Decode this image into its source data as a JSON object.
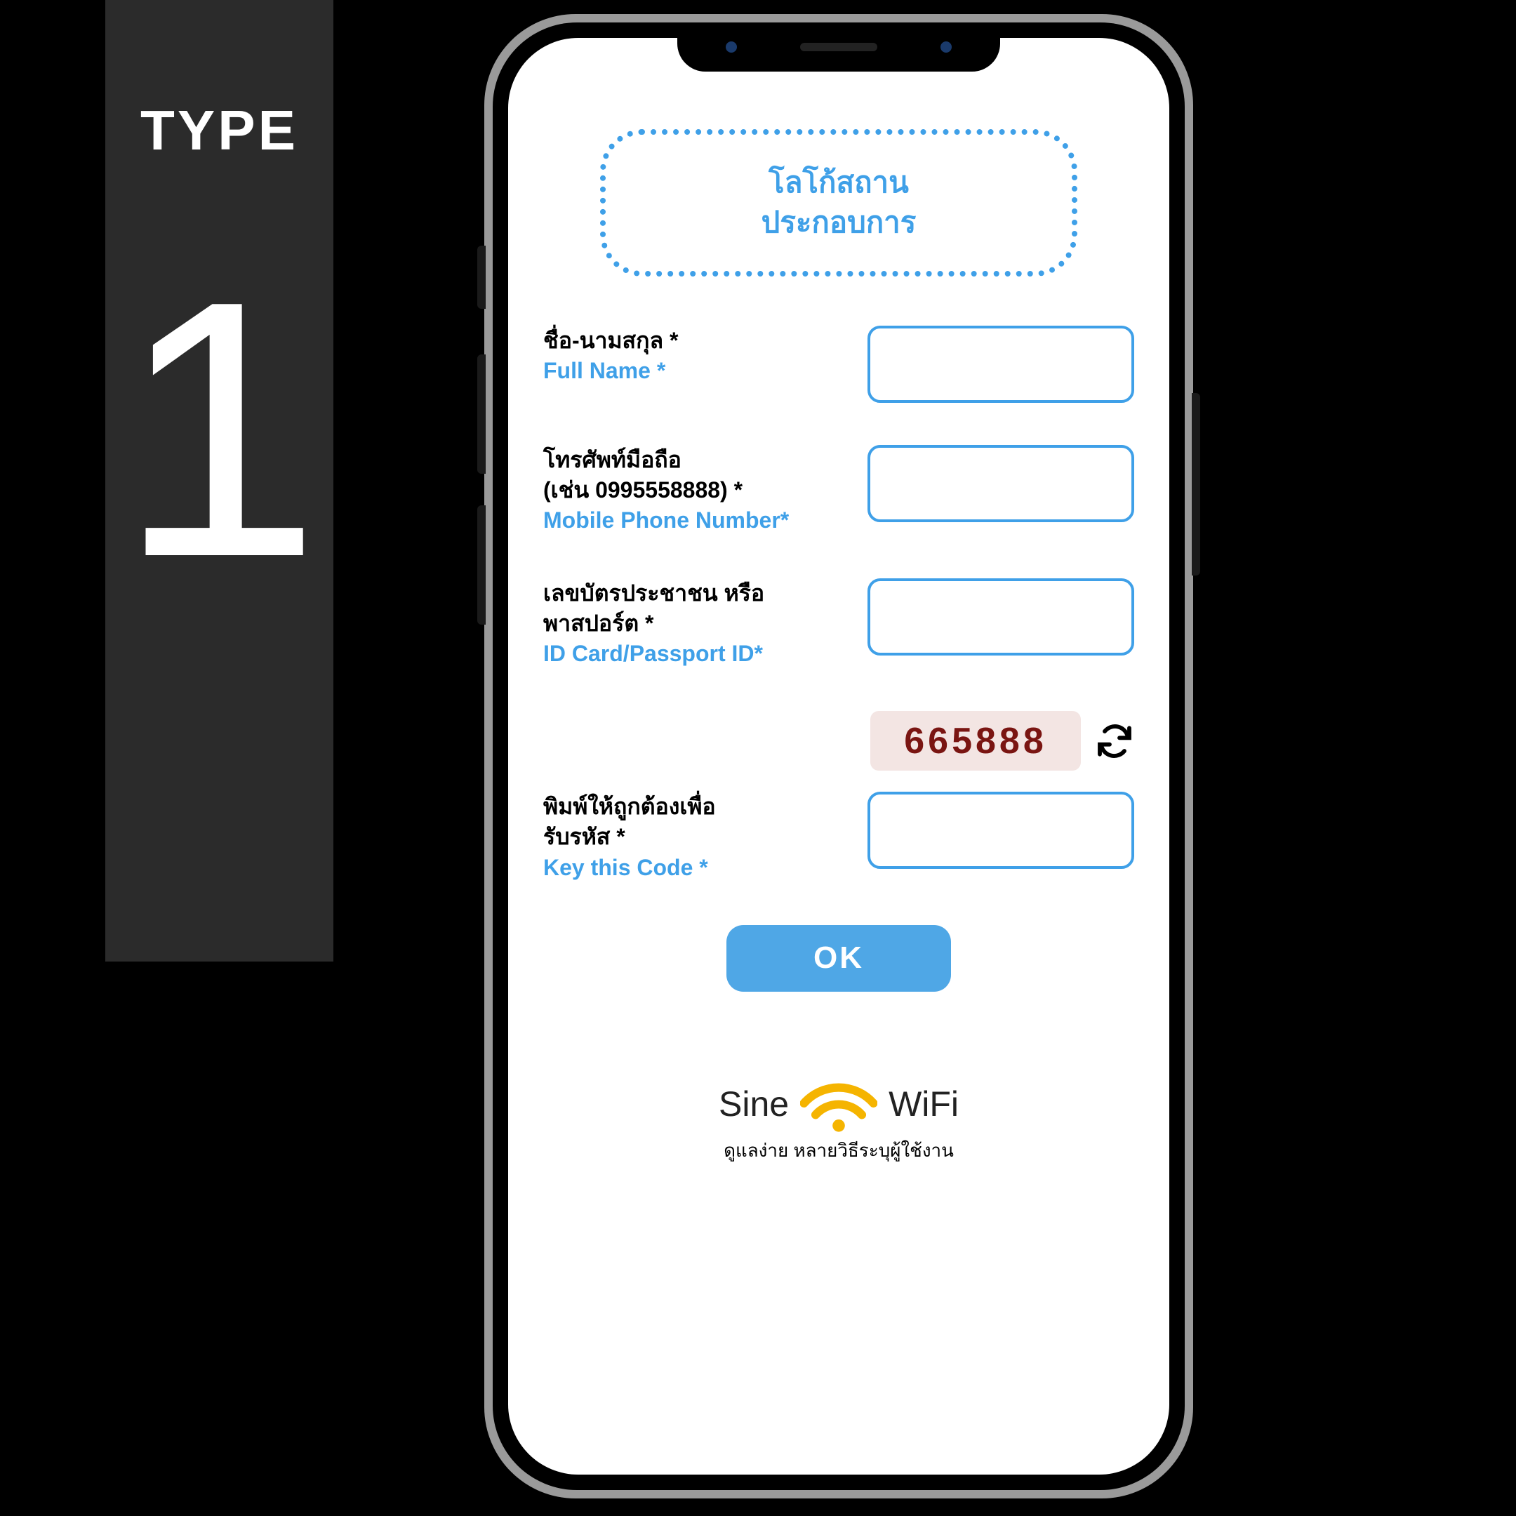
{
  "sidebar": {
    "type_label": "TYPE",
    "type_number": "1"
  },
  "logo_box": {
    "line1": "โลโก้สถาน",
    "line2": "ประกอบการ"
  },
  "fields": {
    "fullname": {
      "th": "ชื่อ-นามสกุล *",
      "en": "Full Name *",
      "value": ""
    },
    "phone": {
      "th_line1": "โทรศัพท์มือถือ",
      "th_line2": "(เช่น 0995558888) *",
      "en": "Mobile Phone Number*",
      "value": ""
    },
    "idcard": {
      "th_line1": "เลขบัตรประชาชน หรือ",
      "th_line2": "พาสปอร์ต *",
      "en": "ID Card/Passport ID*",
      "value": ""
    },
    "captcha": {
      "code": "665888",
      "th_line1": "พิมพ์ให้ถูกต้องเพื่อ",
      "th_line2": "รับรหัส *",
      "en": "Key this Code *",
      "value": ""
    }
  },
  "buttons": {
    "ok": "OK"
  },
  "brand": {
    "name_left": "Sine",
    "name_right": "WiFi",
    "tagline": "ดูแลง่าย หลายวิธีระบุผู้ใช้งาน"
  },
  "colors": {
    "accent": "#3fa0e8",
    "button": "#4fa7e6",
    "captcha_text": "#7a1512",
    "captcha_bg": "#f3e5e3",
    "sidebar_bg": "#2b2b2b",
    "wifi_icon": "#f5b400"
  }
}
